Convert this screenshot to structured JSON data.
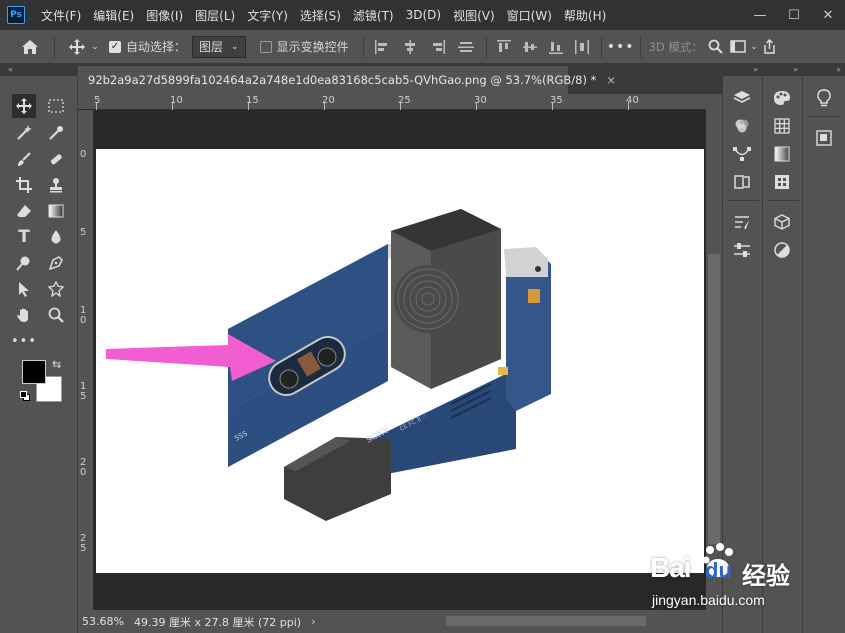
{
  "app": {
    "logo_text": "Ps"
  },
  "menu": [
    "文件(F)",
    "编辑(E)",
    "图像(I)",
    "图层(L)",
    "文字(Y)",
    "选择(S)",
    "滤镜(T)",
    "3D(D)",
    "视图(V)",
    "窗口(W)",
    "帮助(H)"
  ],
  "window_controls": {
    "minimize": "—",
    "maximize": "☐",
    "close": "✕"
  },
  "options": {
    "auto_select_label": "自动选择：",
    "auto_select_checked": true,
    "layer_select_value": "图层",
    "show_transform_label": "显示变换控件",
    "show_transform_checked": false,
    "mode_3d_label": "3D 模式："
  },
  "document": {
    "tab_title": "92b2a9a27d5899fa102464a2a748e1d0ea83168c5cab5-QVhGao.png @ 53.7%(RGB/8) *",
    "close_glyph": "×"
  },
  "ruler": {
    "top_labels": [
      "5",
      "10",
      "15",
      "20",
      "25",
      "30",
      "35",
      "40"
    ],
    "left_labels": [
      "0",
      "5",
      "1\n0",
      "1\n5",
      "2\n0",
      "2\n5"
    ]
  },
  "status": {
    "zoom": "53.68%",
    "doc_size": "49.39 厘米 x 27.8 厘米 (72 ppi)",
    "arrow": "›"
  },
  "product": {
    "brand_text": "SONY",
    "model_text": "SSS",
    "side_text": "CE FC 8 ∷"
  },
  "watermark": {
    "brand": "Bai",
    "paw": "du",
    "cn": "经验",
    "url": "jingyan.baidu.com"
  },
  "colors": {
    "accent_pink": "#f25ed2",
    "device_blue": "#2b4c7e",
    "device_dark": "#4a4a4a"
  }
}
